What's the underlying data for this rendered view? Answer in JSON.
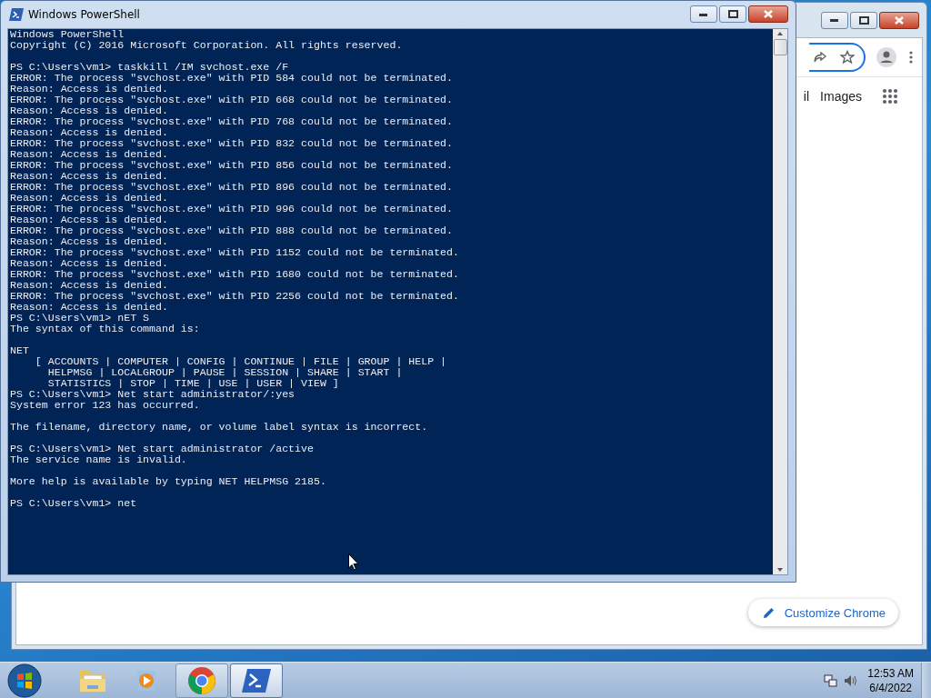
{
  "powershell_window": {
    "title": "Windows PowerShell",
    "console_blocks": [
      [
        "Windows PowerShell",
        "Copyright (C) 2016 Microsoft Corporation. All rights reserved."
      ],
      [
        "PS C:\\Users\\vm1> taskkill /IM svchost.exe /F",
        "ERROR: The process \"svchost.exe\" with PID 584 could not be terminated.",
        "Reason: Access is denied.",
        "ERROR: The process \"svchost.exe\" with PID 668 could not be terminated.",
        "Reason: Access is denied.",
        "ERROR: The process \"svchost.exe\" with PID 768 could not be terminated.",
        "Reason: Access is denied.",
        "ERROR: The process \"svchost.exe\" with PID 832 could not be terminated.",
        "Reason: Access is denied.",
        "ERROR: The process \"svchost.exe\" with PID 856 could not be terminated.",
        "Reason: Access is denied.",
        "ERROR: The process \"svchost.exe\" with PID 896 could not be terminated.",
        "Reason: Access is denied.",
        "ERROR: The process \"svchost.exe\" with PID 996 could not be terminated.",
        "Reason: Access is denied.",
        "ERROR: The process \"svchost.exe\" with PID 888 could not be terminated.",
        "Reason: Access is denied.",
        "ERROR: The process \"svchost.exe\" with PID 1152 could not be terminated.",
        "Reason: Access is denied.",
        "ERROR: The process \"svchost.exe\" with PID 1680 could not be terminated.",
        "Reason: Access is denied.",
        "ERROR: The process \"svchost.exe\" with PID 2256 could not be terminated.",
        "Reason: Access is denied.",
        "PS C:\\Users\\vm1> nET S",
        "The syntax of this command is:"
      ],
      [
        "NET",
        "    [ ACCOUNTS | COMPUTER | CONFIG | CONTINUE | FILE | GROUP | HELP |",
        "      HELPMSG | LOCALGROUP | PAUSE | SESSION | SHARE | START |",
        "      STATISTICS | STOP | TIME | USE | USER | VIEW ]",
        "PS C:\\Users\\vm1> Net start administrator/:yes",
        "System error 123 has occurred."
      ],
      [
        "The filename, directory name, or volume label syntax is incorrect."
      ],
      [
        "PS C:\\Users\\vm1> Net start administrator /active",
        "The service name is invalid."
      ],
      [
        "More help is available by typing NET HELPMSG 2185."
      ],
      [
        "PS C:\\Users\\vm1> net"
      ]
    ]
  },
  "chrome_window": {
    "nav_links": [
      "il",
      "Images"
    ],
    "customize_button": "Customize Chrome"
  },
  "taskbar": {
    "items": [
      {
        "kind": "folder",
        "running": false,
        "selected": false
      },
      {
        "kind": "media",
        "running": false,
        "selected": false
      },
      {
        "kind": "browser",
        "running": true,
        "selected": false
      },
      {
        "kind": "shell",
        "running": true,
        "selected": true
      }
    ],
    "clock": {
      "time": "12:53 AM",
      "date": "6/4/2022"
    }
  }
}
